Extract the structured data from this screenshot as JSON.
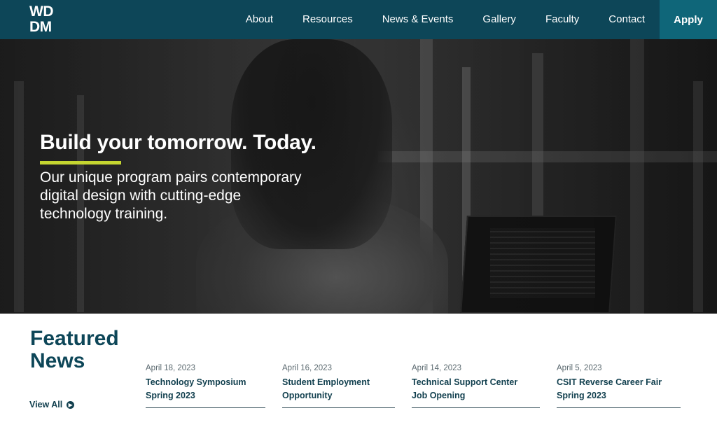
{
  "header": {
    "logo_line1": "WD",
    "logo_line2": "DM",
    "nav": [
      "About",
      "Resources",
      "News & Events",
      "Gallery",
      "Faculty",
      "Contact"
    ],
    "apply_label": "Apply"
  },
  "hero": {
    "title": "Build your tomorrow. Today.",
    "text": "Our unique program pairs contemporary digital design with cutting-edge technology training."
  },
  "news": {
    "heading": "Featured News",
    "view_all": "View All",
    "items": [
      {
        "date": "April 18, 2023",
        "title": "Technology Symposium Spring 2023"
      },
      {
        "date": "April 16, 2023",
        "title": "Student Employment Opportunity"
      },
      {
        "date": "April 14, 2023",
        "title": "Technical Support Center Job Opening"
      },
      {
        "date": "April 5, 2023",
        "title": "CSIT Reverse Career Fair Spring 2023"
      }
    ]
  },
  "colors": {
    "header_bg": "#0d4658",
    "apply_bg": "#0f6679",
    "accent": "#c4d530",
    "text_dark": "#12404f"
  },
  "icons": {
    "view_all": "arrow-circle-right-icon"
  }
}
